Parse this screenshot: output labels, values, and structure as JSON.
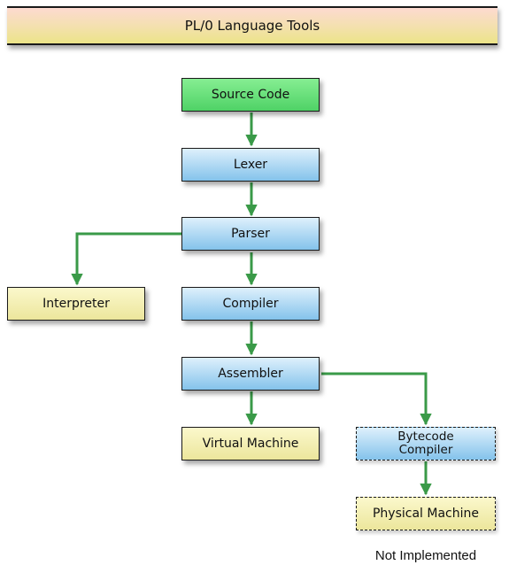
{
  "title": "PL/0 Language Tools",
  "edge_color": "#3a9a48",
  "nodes": {
    "source_code": {
      "label": "Source Code",
      "style": "green"
    },
    "lexer": {
      "label": "Lexer",
      "style": "blue"
    },
    "parser": {
      "label": "Parser",
      "style": "blue"
    },
    "interpreter": {
      "label": "Interpreter",
      "style": "yellow"
    },
    "compiler": {
      "label": "Compiler",
      "style": "blue"
    },
    "assembler": {
      "label": "Assembler",
      "style": "blue"
    },
    "virtual_machine": {
      "label": "Virtual Machine",
      "style": "yellow"
    },
    "bytecode_compiler": {
      "label": "Bytecode Compiler",
      "style": "blue",
      "implemented": false
    },
    "physical_machine": {
      "label": "Physical Machine",
      "style": "yellow",
      "implemented": false
    }
  },
  "edges": [
    {
      "from": "source_code",
      "to": "lexer"
    },
    {
      "from": "lexer",
      "to": "parser"
    },
    {
      "from": "parser",
      "to": "interpreter"
    },
    {
      "from": "parser",
      "to": "compiler"
    },
    {
      "from": "compiler",
      "to": "assembler"
    },
    {
      "from": "assembler",
      "to": "virtual_machine"
    },
    {
      "from": "assembler",
      "to": "bytecode_compiler"
    },
    {
      "from": "bytecode_compiler",
      "to": "physical_machine"
    }
  ],
  "legend": {
    "dashed_meaning": "Not Implemented"
  }
}
